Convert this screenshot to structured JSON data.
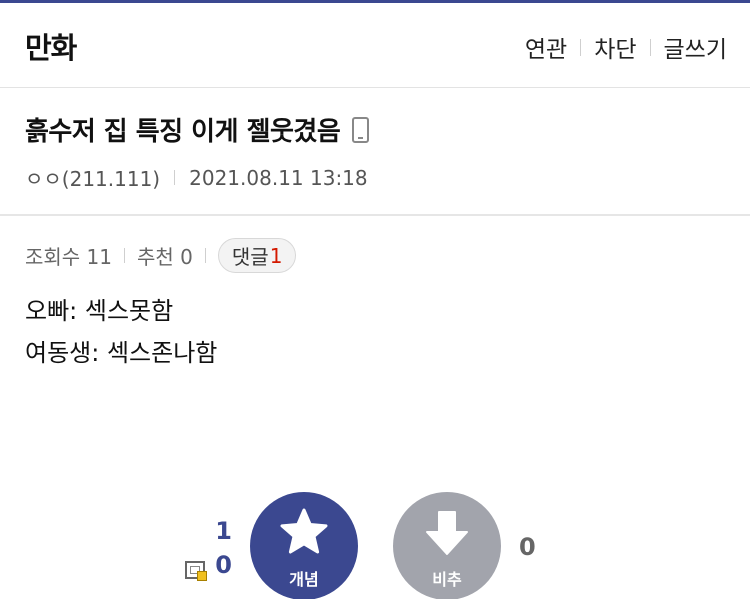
{
  "colors": {
    "accent": "#3b4890",
    "down_button": "#a2a4ac",
    "comment_count": "#d31900"
  },
  "header": {
    "gallery_title": "만화",
    "menu": {
      "related": "연관",
      "block": "차단",
      "write": "글쓰기"
    }
  },
  "post": {
    "title": "흙수저 집 특징 이게 젤웃겼음",
    "device_icon": "mobile-phone-icon",
    "author": "ㅇㅇ(211.111)",
    "date": "2021.08.11 13:18"
  },
  "stats": {
    "views": "조회수 11",
    "recommend": "추천 0",
    "comment_label": "댓글",
    "comment_count": "1"
  },
  "content": {
    "lines": [
      "오빠: 섹스못함",
      "여동생: 섹스존나함"
    ]
  },
  "recommend": {
    "up_count": "1",
    "fix_count": "0",
    "up_label": "개념",
    "down_label": "비추",
    "down_count": "0"
  }
}
